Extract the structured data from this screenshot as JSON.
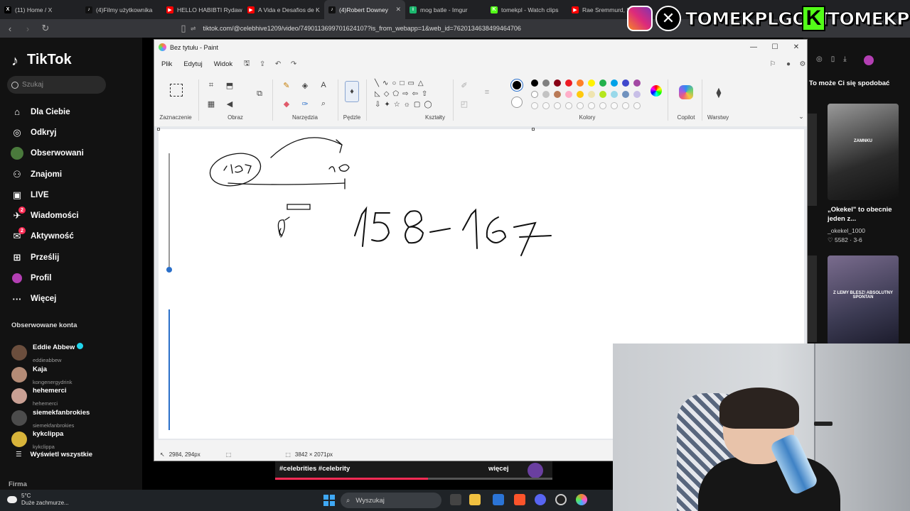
{
  "browser": {
    "tabs": [
      {
        "label": "(11) Home / X",
        "fav_color": "#000000",
        "fav_glyph": "X"
      },
      {
        "label": "(4)Filmy użytkownika",
        "fav_color": "#111111",
        "fav_glyph": "♪"
      },
      {
        "label": "HELLO HABIBTI Rydaw",
        "fav_color": "#ff0000",
        "fav_glyph": "▶"
      },
      {
        "label": "A Vida e Desafios de K",
        "fav_color": "#ff0000",
        "fav_glyph": "▶"
      },
      {
        "label": "(4)Robert Downey",
        "fav_color": "#111111",
        "fav_glyph": "♪",
        "active": true
      },
      {
        "label": "mog batle - Imgur",
        "fav_color": "#1bb76e",
        "fav_glyph": "i"
      },
      {
        "label": "tomekpl - Watch clips",
        "fav_color": "#53fc18",
        "fav_glyph": "K"
      },
      {
        "label": "Rae Sremmurd, S",
        "fav_color": "#ff0000",
        "fav_glyph": "▶"
      }
    ],
    "url": "tiktok.com/@celebhive1209/video/7490113699701624107?is_from_webapp=1&web_id=7620134638499464706"
  },
  "overlay": {
    "handle1": "TOMEKPLGOAT",
    "handle2": "TOMEKPL",
    "x_glyph": "✕",
    "k_glyph": "K"
  },
  "tiktok": {
    "logo": "TikTok",
    "search_placeholder": "Szukaj",
    "nav": [
      {
        "label": "Dla Ciebie",
        "icon": "home-icon",
        "glyph": "⌂"
      },
      {
        "label": "Odkryj",
        "icon": "compass-icon",
        "glyph": "◎"
      },
      {
        "label": "Obserwowani",
        "icon": "following-avatar-icon",
        "glyph": "●"
      },
      {
        "label": "Znajomi",
        "icon": "friends-icon",
        "glyph": "⚇"
      },
      {
        "label": "LIVE",
        "icon": "live-icon",
        "glyph": "▣"
      },
      {
        "label": "Wiadomości",
        "icon": "messages-icon",
        "glyph": "✈",
        "badge": "2"
      },
      {
        "label": "Aktywność",
        "icon": "activity-icon",
        "glyph": "✉",
        "badge": "2"
      },
      {
        "label": "Prześlij",
        "icon": "upload-icon",
        "glyph": "⊞"
      },
      {
        "label": "Profil",
        "icon": "profile-icon",
        "glyph": "●"
      },
      {
        "label": "Więcej",
        "icon": "more-icon",
        "glyph": "···"
      }
    ],
    "following_header": "Obserwowane konta",
    "accounts": [
      {
        "name": "Eddie Abbew",
        "handle": "eddieabbew",
        "verified": true,
        "color": "#6b4e3d"
      },
      {
        "name": "Kaja",
        "handle": "kongenergydrink",
        "verified": false,
        "color": "#b48b76"
      },
      {
        "name": "hehemerci",
        "handle": "hehemerci",
        "verified": false,
        "color": "#c9a094"
      },
      {
        "name": "siemekfanbrokies",
        "handle": "siemekfanbrokies",
        "verified": false,
        "color": "#4c4c4c"
      },
      {
        "name": "kykclippa",
        "handle": "kykclippa",
        "verified": false,
        "color": "#d8b43a"
      }
    ],
    "see_all": "Wyświetl wszystkie",
    "firma": "Firma",
    "suggest_header": "To może Ci się spodobać",
    "suggestions": [
      {
        "caption": "ZAMNKU",
        "title": "„Okekel\" to obecnie jeden z...",
        "user": "_okekel_1000",
        "stats": "♡ 5582 · 3-6"
      },
      {
        "caption": "Z LEMY BLESZ! ABSOLUTNY SPONTAN",
        "title": "",
        "user": "",
        "stats": ""
      }
    ],
    "hashtags": "#celebrities #celebrity",
    "more_label": "więcej",
    "progress": 0.55
  },
  "paint": {
    "title": "Bez tytułu - Paint",
    "menu": [
      "Plik",
      "Edytuj",
      "Widok"
    ],
    "groups": [
      "Zaznaczenie",
      "Obraz",
      "Narzędzia",
      "Pędzle",
      "Kształty",
      "Kolory",
      "Copilot",
      "Warstwy"
    ],
    "status_coords": "2984, 294px",
    "status_size": "3842 × 2071px",
    "colors_row1": [
      "#000000",
      "#7f7f7f",
      "#880015",
      "#ed1c24",
      "#ff7f27",
      "#fff200",
      "#22b14c",
      "#00a2e8",
      "#3f48cc",
      "#a349a4"
    ],
    "colors_row2": [
      "#ffffff",
      "#c3c3c3",
      "#b97a57",
      "#ffaec9",
      "#ffc90e",
      "#efe4b0",
      "#b5e61d",
      "#99d9ea",
      "#7092be",
      "#c8bfe7"
    ]
  },
  "taskbar": {
    "temp": "5°C",
    "weather": "Duże zachmurze...",
    "search": "Wyszukaj"
  }
}
